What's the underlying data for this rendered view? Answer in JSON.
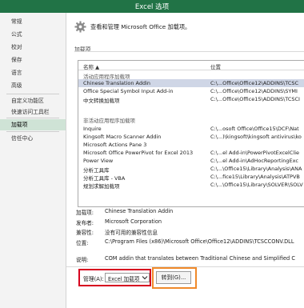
{
  "window": {
    "title": "Excel 选项"
  },
  "sidebar": {
    "items": [
      {
        "label": "常规",
        "active": false
      },
      {
        "label": "公式",
        "active": false
      },
      {
        "label": "校对",
        "active": false
      },
      {
        "label": "保存",
        "active": false
      },
      {
        "label": "语言",
        "active": false
      },
      {
        "label": "高级",
        "active": false
      },
      {
        "label": "自定义功能区",
        "active": false
      },
      {
        "label": "快速访问工具栏",
        "active": false
      },
      {
        "label": "加载项",
        "active": true
      },
      {
        "label": "信任中心",
        "active": false
      }
    ]
  },
  "header": {
    "icon": "gear-icon",
    "text": "查看和管理 Microsoft Office 加载项。"
  },
  "section": {
    "label": "加载项"
  },
  "table": {
    "col_name": "名称 ▲",
    "col_location": "位置",
    "rows": [
      {
        "name": "活动应用程序加载项",
        "location": "",
        "group": true
      },
      {
        "name": "Chinese Translation Addin",
        "location": "C:\\...Office\\Office12\\ADDINS\\TCSC",
        "selected": true
      },
      {
        "name": "Office Special Symbol Input Add-in",
        "location": "C:\\...Office\\Office12\\ADDINS\\SYMI"
      },
      {
        "name": "中文转换加载项",
        "location": "C:\\...Office\\Office15\\ADDINS\\TCSCI"
      },
      {
        "name": "",
        "location": ""
      },
      {
        "name": "非活动应用程序加载项",
        "location": "",
        "group": true
      },
      {
        "name": "Inquire",
        "location": "C:\\...osoft Office\\Office15\\DCF\\Nat"
      },
      {
        "name": "Kingsoft Macro Scanner Addin",
        "location": "C:\\...)\\kingsoft\\kingsoft antivirus\\ko"
      },
      {
        "name": "Microsoft Actions Pane 3",
        "location": ""
      },
      {
        "name": "Microsoft Office PowerPivot for Excel 2013",
        "location": "C:\\...el Add-in\\PowerPivotExcelClie"
      },
      {
        "name": "Power View",
        "location": "C:\\...el Add-in\\AdHocReportingExc"
      },
      {
        "name": "分析工具库",
        "location": "C:\\...\\Office15\\Library\\Analysis\\ANA"
      },
      {
        "name": "分析工具库 - VBA",
        "location": "C:\\...fice15\\Library\\Analysis\\ATPVB"
      },
      {
        "name": "规划求解加载项",
        "location": "C:\\...\\Office15\\Library\\SOLVER\\SOLV"
      }
    ]
  },
  "details": [
    {
      "key": "加载项:",
      "value": "Chinese Translation Addin"
    },
    {
      "key": "发布者:",
      "value": "Microsoft Corporation"
    },
    {
      "key": "兼容性:",
      "value": "没有可用的兼容性信息"
    },
    {
      "key": "位置:",
      "value": "C:\\Program Files (x86)\\Microsoft Office\\Office12\\ADDINS\\TCSCCONV.DLL"
    },
    {
      "key": "说明:",
      "value": "COM addin that translates between Traditional Chinese and Simplified C"
    }
  ],
  "manage": {
    "label": "管理(A):",
    "selected": "Excel 加载项",
    "go_label": "转到(G)..."
  },
  "colors": {
    "title_bar": "#217346",
    "highlight_red": "#d7001f",
    "highlight_orange": "#f0892a",
    "sidebar_active": "#cfe3d6",
    "row_selected": "#cfd6e6"
  }
}
